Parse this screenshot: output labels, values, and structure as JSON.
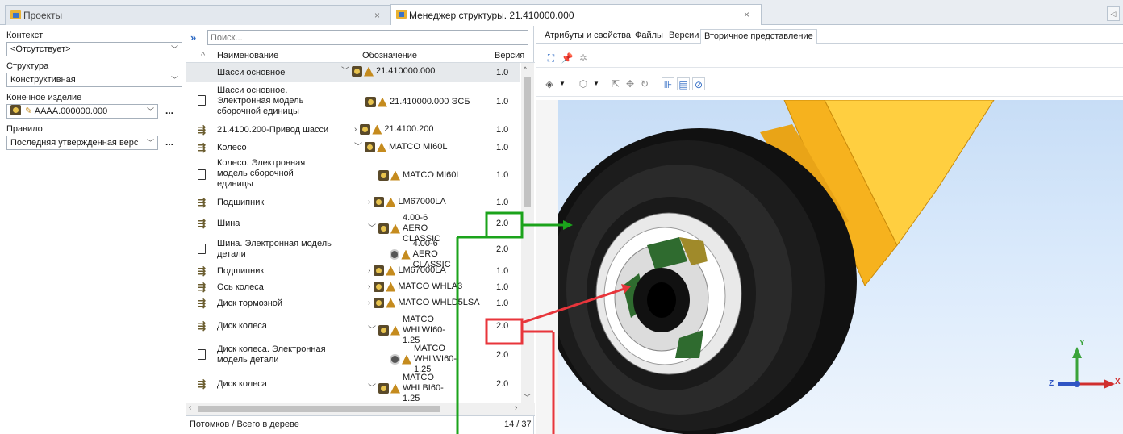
{
  "tabs": {
    "projects": "Проекты",
    "manager": "Менеджер структуры. 21.410000.000"
  },
  "left_panel": {
    "context_label": "Контекст",
    "context_value": "<Отсутствует>",
    "structure_label": "Структура",
    "structure_value": "Конструктивная",
    "final_item_label": "Конечное изделие",
    "final_item_value": "AAAA.000000.000",
    "rule_label": "Правило",
    "rule_value": "Последняя утвержденная верс",
    "ellipsis": "..."
  },
  "tree": {
    "search_placeholder": "Поиск...",
    "headers": {
      "name": "Наименование",
      "designation": "Обозначение",
      "version": "Версия"
    },
    "rows": [
      {
        "name": "Шасси основное",
        "designation": "21.410000.000",
        "version": "1.0"
      },
      {
        "name": "Шасси основное. Электронная модель сборочной единицы",
        "designation": "21.410000.000 ЭСБ",
        "version": "1.0"
      },
      {
        "name": "21.4100.200-Привод шасси",
        "designation": "21.4100.200",
        "version": "1.0"
      },
      {
        "name": "Колесо",
        "designation": "MATCO MI60L",
        "version": "1.0"
      },
      {
        "name": "Колесо. Электронная модель сборочной единицы",
        "designation": "MATCO MI60L",
        "version": "1.0"
      },
      {
        "name": "Подшипник",
        "designation": "LM67000LA",
        "version": "1.0"
      },
      {
        "name": "Шина",
        "designation": "4.00-6 AERO CLASSIC",
        "version": "2.0"
      },
      {
        "name": "Шина. Электронная модель детали",
        "designation": "4.00-6 AERO CLASSIC",
        "version": "2.0"
      },
      {
        "name": "Подшипник",
        "designation": "LM67000LA",
        "version": "1.0"
      },
      {
        "name": "Ось колеса",
        "designation": "MATCO WHLA3",
        "version": "1.0"
      },
      {
        "name": "Диск тормозной",
        "designation": "MATCO WHLD5LSA",
        "version": "1.0"
      },
      {
        "name": "Диск колеса",
        "designation": "MATCO WHLWI60-1.25",
        "version": "2.0"
      },
      {
        "name": "Диск колеса. Электронная модель детали",
        "designation": "MATCO WHLWI60-1.25",
        "version": "2.0"
      },
      {
        "name": "Диск колеса",
        "designation": "MATCO WHLBI60-1.25",
        "version": "2.0"
      }
    ],
    "status_label": "Потомков / Всего в дереве",
    "status_count": "14 / 37"
  },
  "right_panel": {
    "tabs": [
      "Атрибуты и свойства",
      "Файлы",
      "Версии",
      "Вторичное представление"
    ],
    "axis_x": "X",
    "axis_y": "Y",
    "axis_z": "Z"
  },
  "colors": {
    "green": "#1ba31b",
    "red": "#e8353b",
    "selected": "#e6e9ec",
    "accent": "#2f6bc4",
    "rim": "#ffc21a"
  }
}
